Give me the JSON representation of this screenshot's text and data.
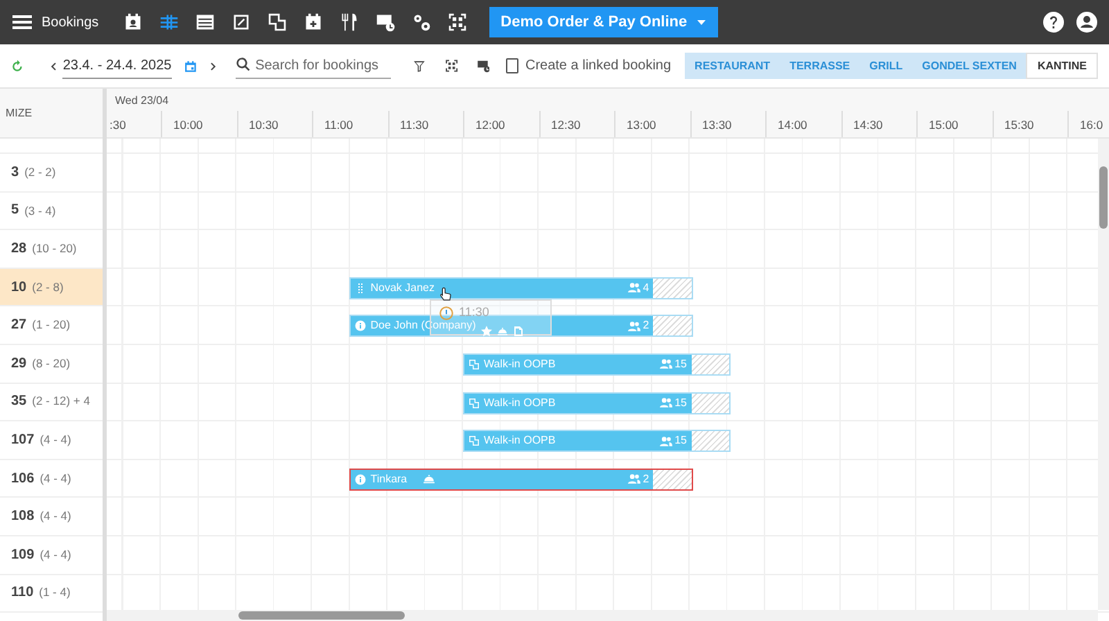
{
  "navbar": {
    "title": "Bookings",
    "icons": [
      {
        "kind": "calendar-person",
        "selected": false
      },
      {
        "kind": "timeline",
        "selected": true
      },
      {
        "kind": "list",
        "selected": false
      },
      {
        "kind": "floorplan",
        "selected": false
      },
      {
        "kind": "copy",
        "selected": false
      },
      {
        "kind": "calendar-plus",
        "selected": false
      },
      {
        "kind": "cutlery",
        "selected": false
      },
      {
        "kind": "card-clock",
        "selected": false
      },
      {
        "kind": "settings",
        "selected": false
      },
      {
        "kind": "qr",
        "selected": false
      }
    ],
    "venue_button": "Demo Order & Pay Online"
  },
  "toolbar": {
    "date_range": "23.4. - 24.4. 2025",
    "search": {
      "placeholder": "Search for bookings"
    },
    "linked_booking": {
      "label": "Create a linked booking",
      "checked": false
    },
    "areas": [
      {
        "label": "RESTAURANT",
        "selected": false
      },
      {
        "label": "TERRASSE",
        "selected": false
      },
      {
        "label": "GRILL",
        "selected": false
      },
      {
        "label": "GONDEL SEXTEN",
        "selected": false
      },
      {
        "label": "KANTINE",
        "selected": true
      }
    ]
  },
  "timeline": {
    "corner_label": "MIZE",
    "day": "Wed 23/04",
    "times": [
      ":30",
      "10:00",
      "10:30",
      "11:00",
      "11:30",
      "12:00",
      "12:30",
      "13:00",
      "13:30",
      "14:00",
      "14:30",
      "15:00",
      "15:30",
      "16:0"
    ],
    "rows": [
      {
        "table": "3",
        "capacity": "(2 - 2)",
        "selected": false,
        "bookings": []
      },
      {
        "table": "5",
        "capacity": "(3 - 4)",
        "selected": false,
        "bookings": []
      },
      {
        "table": "28",
        "capacity": "(10 - 20)",
        "selected": false,
        "bookings": []
      },
      {
        "table": "10",
        "capacity": "(2 - 8)",
        "selected": true,
        "bookings": [
          {
            "kind": "dragging",
            "name": "Novak Janez",
            "guests": "4",
            "flagged": false
          }
        ]
      },
      {
        "table": "27",
        "capacity": "(1 - 20)",
        "selected": false,
        "bookings": [
          {
            "kind": "reservation",
            "name": "Doe John (Company)",
            "guests": "2",
            "flagged": false
          }
        ]
      },
      {
        "table": "29",
        "capacity": "(8 - 20)",
        "selected": false,
        "bookings": [
          {
            "kind": "walk-in",
            "name": "Walk-in OOPB",
            "guests": "15",
            "flagged": false
          }
        ]
      },
      {
        "table": "35",
        "capacity": "(2 - 12) + 4",
        "selected": false,
        "bookings": [
          {
            "kind": "walk-in",
            "name": "Walk-in OOPB",
            "guests": "15",
            "flagged": false
          }
        ]
      },
      {
        "table": "107",
        "capacity": "(4 - 4)",
        "selected": false,
        "bookings": [
          {
            "kind": "walk-in",
            "name": "Walk-in OOPB",
            "guests": "15",
            "flagged": false
          }
        ]
      },
      {
        "table": "106",
        "capacity": "(4 - 4)",
        "selected": false,
        "bookings": [
          {
            "kind": "reservation",
            "name": "Tinkara",
            "cloche": true,
            "guests": "2",
            "flagged": true
          }
        ]
      },
      {
        "table": "108",
        "capacity": "(4 - 4)",
        "selected": false,
        "bookings": []
      },
      {
        "table": "109",
        "capacity": "(4 - 4)",
        "selected": false,
        "bookings": []
      },
      {
        "table": "110",
        "capacity": "(1 - 4)",
        "selected": false,
        "bookings": []
      }
    ],
    "drag_preview": {
      "time": "11:30"
    }
  }
}
